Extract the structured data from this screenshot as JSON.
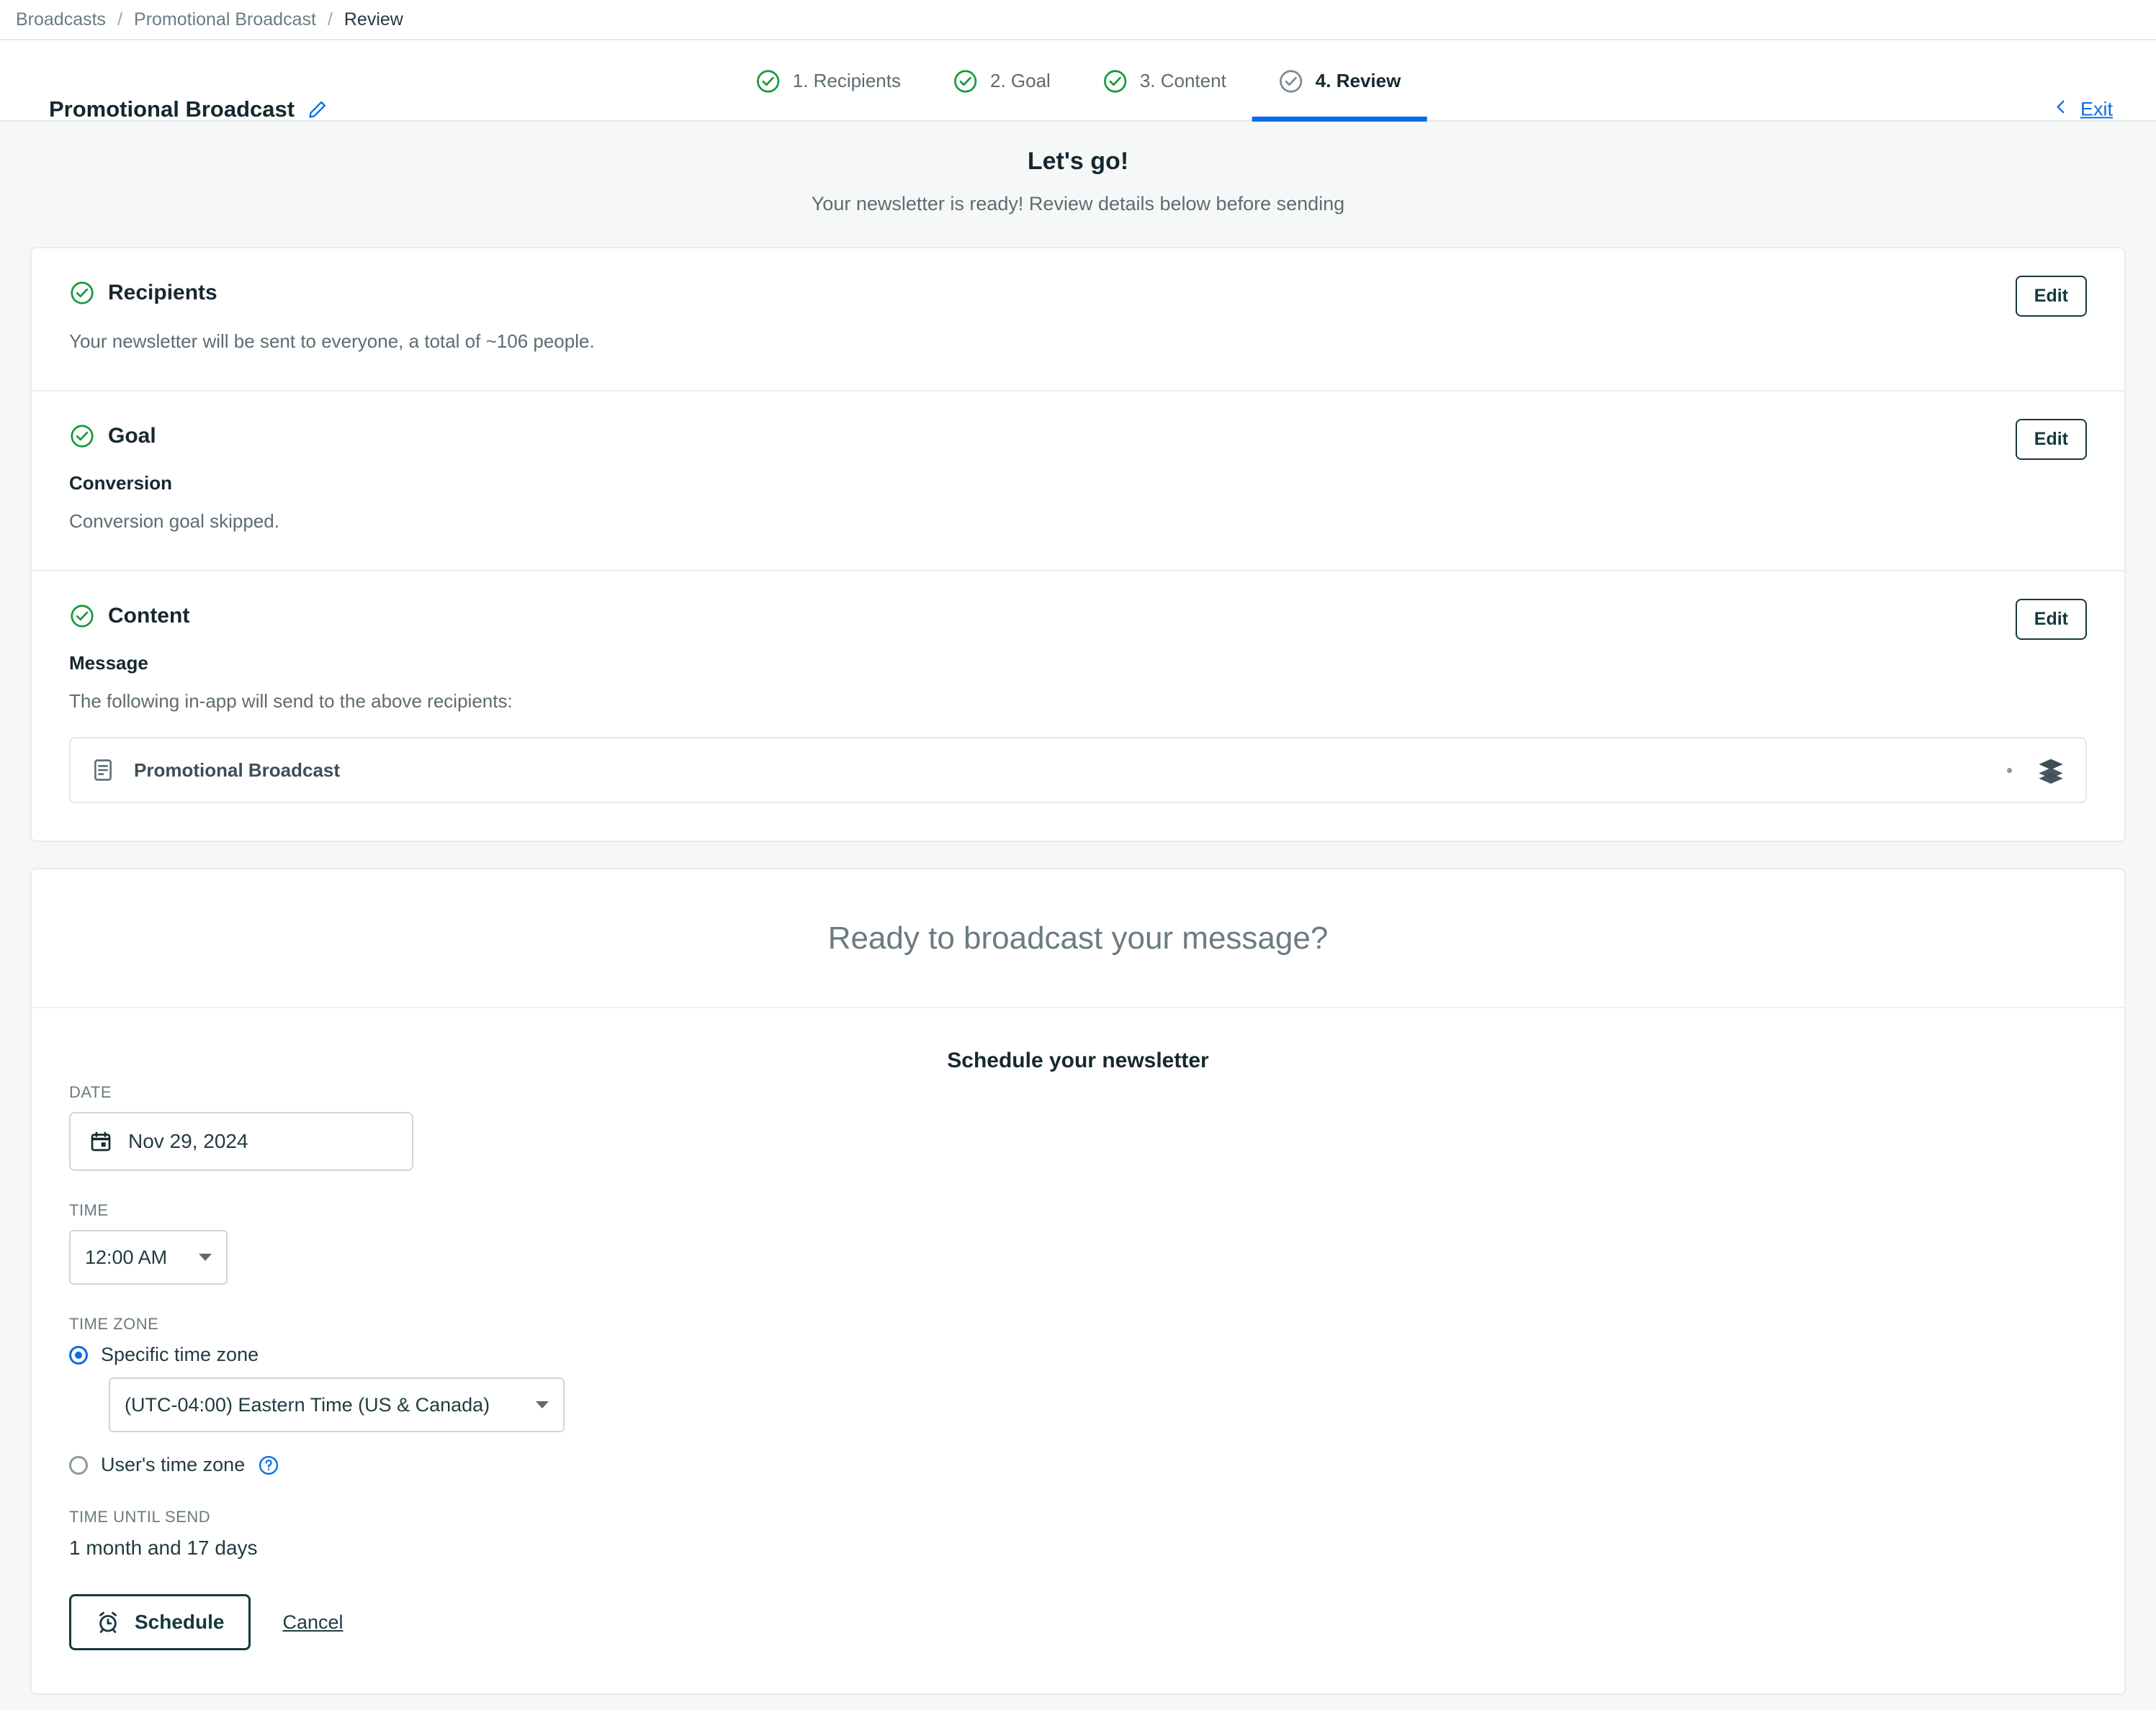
{
  "breadcrumb": {
    "items": [
      "Broadcasts",
      "Promotional Broadcast",
      "Review"
    ],
    "separator": "/"
  },
  "header": {
    "title": "Promotional Broadcast",
    "edit_title_icon": "pencil-icon",
    "exit_label": "Exit",
    "exit_chevron": "chevron-left-icon",
    "steps": [
      {
        "label": "1. Recipients",
        "state": "complete"
      },
      {
        "label": "2. Goal",
        "state": "complete"
      },
      {
        "label": "3. Content",
        "state": "complete"
      },
      {
        "label": "4. Review",
        "state": "active"
      }
    ]
  },
  "hero": {
    "title": "Let's go!",
    "subtitle": "Your newsletter is ready! Review details below before sending"
  },
  "review": {
    "edit_label": "Edit",
    "recipients": {
      "title": "Recipients",
      "detail": "Your newsletter will be sent to everyone, a total of ~106 people."
    },
    "goal": {
      "title": "Goal",
      "sub_label": "Conversion",
      "detail": "Conversion goal skipped."
    },
    "content": {
      "title": "Content",
      "sub_label": "Message",
      "detail": "The following in-app will send to the above recipients:",
      "message_name": "Promotional Broadcast",
      "message_icon": "in-app-message-icon",
      "trailing_icon": "layers-icon"
    }
  },
  "broadcast": {
    "heading": "Ready to broadcast your message?",
    "schedule_title": "Schedule your newsletter",
    "date_label": "DATE",
    "date_value": "Nov 29, 2024",
    "date_icon": "calendar-icon",
    "time_label": "TIME",
    "time_value": "12:00 AM",
    "timezone_label": "TIME ZONE",
    "specific_tz_label": "Specific time zone",
    "specific_tz_selected": true,
    "timezone_value": "(UTC-04:00) Eastern Time (US & Canada)",
    "user_tz_label": "User's time zone",
    "user_tz_selected": false,
    "help_icon": "question-mark-icon",
    "until_label": "TIME UNTIL SEND",
    "until_value": "1 month and 17 days",
    "schedule_button": "Schedule",
    "schedule_icon": "alarm-clock-icon",
    "cancel_label": "Cancel"
  },
  "colors": {
    "accent_blue": "#0b6ee8",
    "success_green": "#139a3c",
    "dark_teal": "#16383f",
    "muted_text": "#5d6b72",
    "page_bg": "#f6f8f8"
  }
}
